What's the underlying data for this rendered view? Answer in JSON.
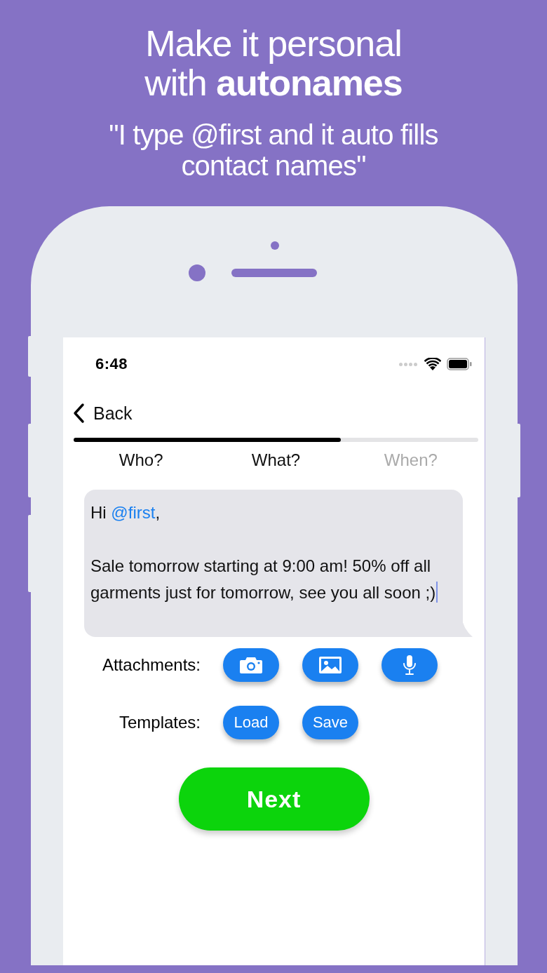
{
  "headline": {
    "lines": [
      "Make it personal",
      "with **autonames**"
    ]
  },
  "quote": {
    "lines": [
      "\"I type @first and it auto fills",
      "contact names\""
    ]
  },
  "status_bar": {
    "time": "6:48"
  },
  "nav": {
    "back": "Back"
  },
  "progress": {
    "level": 0.66
  },
  "steps": [
    {
      "label": "Who?",
      "reached": true
    },
    {
      "label": "What?",
      "reached": true
    },
    {
      "label": "When?",
      "reached": false
    }
  ],
  "message": {
    "parts": [
      {
        "kind": "plain",
        "text": "Hi "
      },
      {
        "kind": "mention",
        "text": "@first"
      },
      {
        "kind": "plain",
        "text": ",\n\nSale tomorrow starting at 9:00 am! 50% off all garments just for tomorrow, see you all soon ;)"
      }
    ]
  },
  "attachments": {
    "label": "Attachments:",
    "buttons": [
      {
        "kind": "camera"
      },
      {
        "kind": "image"
      },
      {
        "kind": "microphone"
      }
    ]
  },
  "templates": {
    "label": "Templates:",
    "buttons": [
      "Load",
      "Save"
    ]
  },
  "next_button": "Next"
}
